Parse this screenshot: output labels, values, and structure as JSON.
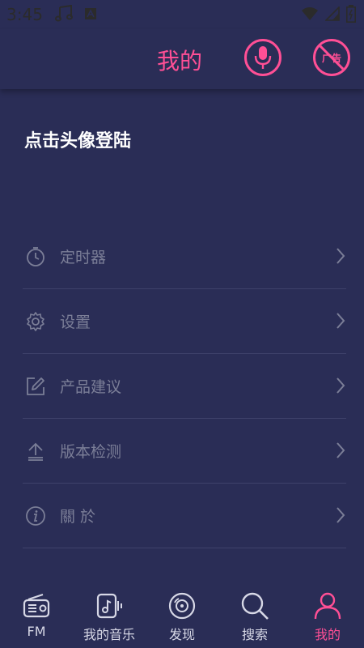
{
  "status_bar": {
    "time": "3:45"
  },
  "header": {
    "title": "我的",
    "noad_text": "广告"
  },
  "login_prompt": "点击头像登陆",
  "menu": [
    {
      "icon": "timer-icon",
      "label": "定时器"
    },
    {
      "icon": "gear-icon",
      "label": "设置"
    },
    {
      "icon": "edit-icon",
      "label": "产品建议"
    },
    {
      "icon": "upload-icon",
      "label": "版本检测"
    },
    {
      "icon": "info-icon",
      "label": "關 於"
    }
  ],
  "bottom_nav": [
    {
      "icon": "radio-icon",
      "label": "FM",
      "active": false
    },
    {
      "icon": "music-icon",
      "label": "我的音乐",
      "active": false
    },
    {
      "icon": "disc-icon",
      "label": "发现",
      "active": false
    },
    {
      "icon": "search-icon",
      "label": "搜索",
      "active": false
    },
    {
      "icon": "user-icon",
      "label": "我的",
      "active": true
    }
  ],
  "colors": {
    "background": "#2a2d56",
    "accent": "#ff4f95",
    "muted": "#7b7e97"
  }
}
